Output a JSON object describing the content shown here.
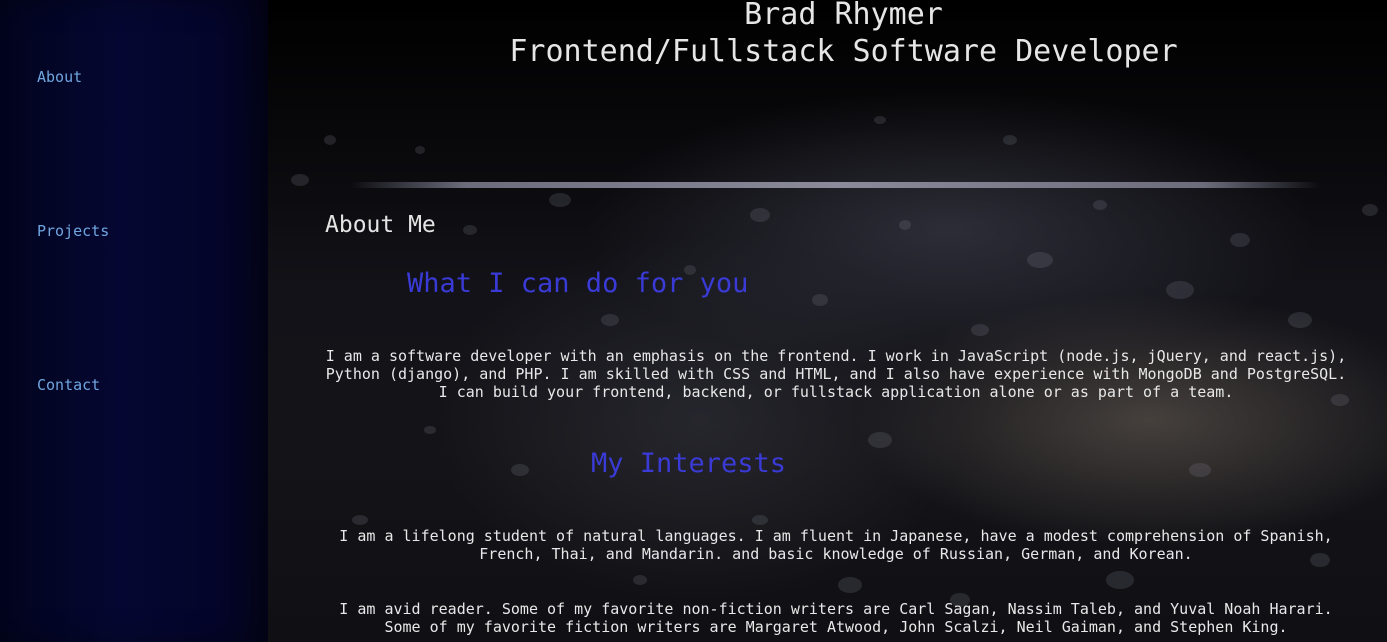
{
  "sidebar": {
    "items": [
      {
        "label": "About"
      },
      {
        "label": "Projects"
      },
      {
        "label": "Contact"
      }
    ]
  },
  "header": {
    "name": "Brad Rhymer",
    "role": "Frontend/Fullstack Software Developer"
  },
  "main": {
    "section_title": "About Me",
    "what_heading": "What I can do for you",
    "what_text": "I am a software developer with an emphasis on the frontend. I work in JavaScript (node.js, jQuery, and react.js), Python (django), and PHP. I am skilled with CSS and HTML, and I also have experience with MongoDB and PostgreSQL. I can build your frontend, backend, or fullstack application alone or as part of a team.",
    "interests_heading": "My Interests",
    "interests_text_1": "I am a lifelong student of natural languages. I am fluent in Japanese, have a modest comprehension of Spanish, French, Thai, and Mandarin. and basic knowledge of Russian, German, and Korean.",
    "interests_text_2": "I am avid reader. Some of my favorite non-fiction writers are Carl Sagan, Nassim Taleb, and Yuval Noah Harari. Some of my favorite fiction writers are Margaret Atwood, John Scalzi, Neil Gaiman, and Stephen King."
  },
  "colors": {
    "nav_link": "#6fa6e0",
    "heading_blue": "#3a3ad6",
    "text": "#e8e8e8",
    "sidebar_bg": "#050732"
  }
}
